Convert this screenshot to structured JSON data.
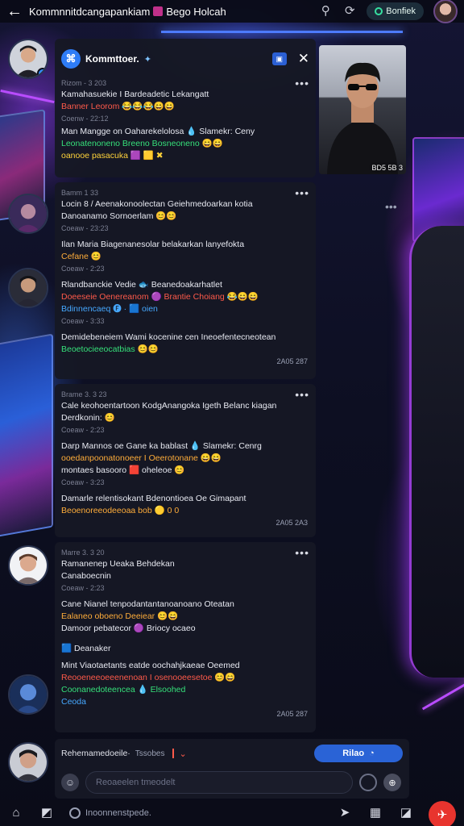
{
  "header": {
    "back_icon": "arrow-left-icon",
    "title": "Kommnnitdcangapankiam",
    "title_suffix": "Bego Holcah",
    "search_icon": "search-icon",
    "refresh_icon": "refresh-icon",
    "status_label": "Bonfiek",
    "avatar_icon": "user-avatar"
  },
  "chat_header": {
    "brand_name": "Kommttoer.",
    "brand_icon": "group-logo-icon",
    "verified_icon": "verified-icon",
    "pin_icon": "pin-icon",
    "close_icon": "close-icon"
  },
  "messages": [
    {
      "meta": "Rizom - 3 203",
      "lines": [
        {
          "text": "Kamahasuekie I Bardeadetic Lekangatt",
          "color": "white"
        },
        {
          "text": "Banner Leorom 😂😂😂😄😄",
          "color": "red"
        }
      ],
      "ts": "Coenw - 22:12"
    },
    {
      "meta": "",
      "lines": [
        {
          "text": "Man Mangge on Oaharekelolosa 💧 Slamekr: Ceny",
          "color": "white"
        },
        {
          "text": "Leonatenoneno Breeno Bosneoneno 😄😄",
          "color": "green"
        },
        {
          "text": "oanooe pasacuka 🟪 🟨 ✖",
          "color": "yellow"
        }
      ],
      "ts": ""
    },
    {
      "meta": "Bamm 1  33",
      "lines": [
        {
          "text": "Locin 8 / Aeenakonoolectan Geiehmedoarkan kotia",
          "color": "white"
        },
        {
          "text": "Danoanamo Sornoerlam 😊😊",
          "color": "white"
        }
      ],
      "ts": "Coeaw - 23:23"
    },
    {
      "meta": "",
      "lines": [
        {
          "text": "Ilan Maria Biagenanesolar belakarkan lanyefokta",
          "color": "white"
        },
        {
          "text": "Cefane 😊",
          "color": "orange"
        }
      ],
      "ts": "Coeaw - 2:23"
    },
    {
      "meta": "",
      "lines": [
        {
          "text": "Rlandbanckie Vedie 🐟 Beanedoakarhatlet",
          "color": "white"
        },
        {
          "text": "Doeeseie Oenereanom 🟣 Brantie Choiang 😂😄😄",
          "color": "red"
        },
        {
          "text": "Bdinnencaeq 🅕 ·  🟦 oien",
          "color": "blue"
        }
      ],
      "ts": "Coeaw - 3:33"
    },
    {
      "meta": "",
      "lines": [
        {
          "text": "Demidebeneiem Wami kocenine cen Ineoefentecneotean",
          "color": "white"
        },
        {
          "text": "Beoetocieeocatbias 😊😊",
          "color": "green"
        }
      ],
      "ts": ""
    },
    {
      "meta": "Brame 3. 3 23",
      "lines": [
        {
          "text": "Cale keohoentartoon KodgAnangoka Igeth Belanc kiagan",
          "color": "white"
        },
        {
          "text": "Derdkonin: 😊",
          "color": "white"
        }
      ],
      "ts": "Coeaw - 2:23"
    },
    {
      "meta": "",
      "lines": [
        {
          "text": "Darp Mannos oe Gane ka bablast 💧 Slamekr: Cenrg",
          "color": "white"
        },
        {
          "text": "ooedanpoonatonoeer I Oeerotonane 😄😄",
          "color": "orange"
        },
        {
          "text": "montaes basooro 🟥 oheleoe 😊",
          "color": "white"
        }
      ],
      "ts": "Coeaw - 3:23"
    },
    {
      "meta": "",
      "lines": [
        {
          "text": "Damarle relentisokant Bdenontioea Oe Gimapant",
          "color": "white"
        },
        {
          "text": "Beoenoreeodeeoaa bob 🟡 0 0",
          "color": "orange"
        }
      ],
      "ts": ""
    },
    {
      "meta": "Marre 3. 3 20",
      "lines": [
        {
          "text": "Ramanenep Ueaka Behdekan",
          "color": "white"
        },
        {
          "text": "Canaboecnin",
          "color": "white"
        }
      ],
      "ts": "Coeaw - 2:23"
    },
    {
      "meta": "",
      "lines": [
        {
          "text": "Cane Nianel tenpodantantanoanoano Oteatan",
          "color": "white"
        },
        {
          "text": "Ealaneo oboeno Deeiear 😊😄",
          "color": "orange"
        },
        {
          "text": "Damoor pebatecor 🟣 Briocy ocaeo",
          "color": "white"
        }
      ],
      "ts": ""
    },
    {
      "meta": "",
      "lines": [
        {
          "text": "🟦 Deanaker",
          "color": "white"
        }
      ],
      "ts": ""
    },
    {
      "meta": "",
      "lines": [
        {
          "text": "Mint Viaotaetants eatde oochahjkaeae Oeemed",
          "color": "white"
        },
        {
          "text": "Reooeneeoeeenenoan I osenooeesetoe 😊😄",
          "color": "red"
        },
        {
          "text": "Coonanedoteencea 💧 Elsoohed",
          "color": "green"
        },
        {
          "text": "Ceoda",
          "color": "blue"
        }
      ],
      "ts": ""
    }
  ],
  "panel_timestamps": {
    "p2": "2A05  287",
    "p3": "2A05  2A3",
    "p4": "2A05  287"
  },
  "photo": {
    "caption": "BD5  5B 3",
    "subject": "man-with-sunglasses"
  },
  "composer": {
    "reply_label": "Rehemamedoeile·",
    "reply_sub": "Tssobes",
    "send_label": "Rilao",
    "send_icon": "send-icon",
    "input_placeholder": "Reoaeelen tmeodelt",
    "emoji_icon": "emoji-icon",
    "record_icon": "record-icon",
    "attach_icon": "attach-icon"
  },
  "bottom_nav": {
    "home_icon": "home-icon",
    "chat_icon": "chat-icon",
    "search_placeholder": "Inoonnenstpede.",
    "share_icon": "share-icon",
    "grid_icon": "grid-icon",
    "gallery_icon": "gallery-icon",
    "fab_icon": "bird-icon"
  },
  "colors": {
    "accent": "#2a63d6",
    "status_ring": "#36e0a0",
    "fab": "#e8342e",
    "panel": "#161824"
  }
}
